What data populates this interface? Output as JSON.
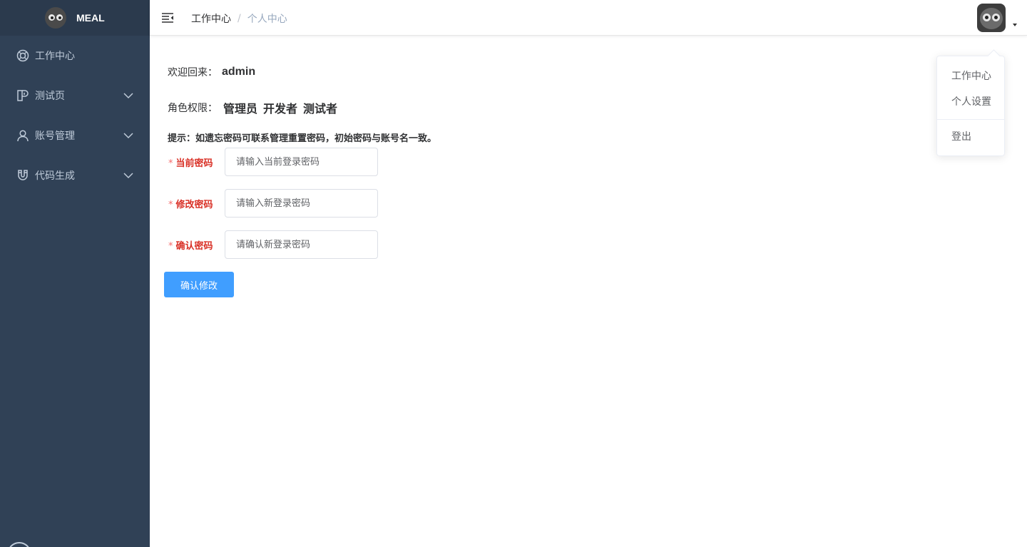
{
  "brand": {
    "title": "MEAL"
  },
  "sidebar": {
    "items": [
      {
        "label": "工作中心",
        "icon": "dashboard-icon",
        "expandable": false
      },
      {
        "label": "测试页",
        "icon": "test-page-icon",
        "expandable": true
      },
      {
        "label": "账号管理",
        "icon": "user-icon",
        "expandable": true
      },
      {
        "label": "代码生成",
        "icon": "magnet-icon",
        "expandable": true
      }
    ]
  },
  "header": {
    "breadcrumb": [
      "工作中心",
      "个人中心"
    ],
    "separator": "/"
  },
  "dropdown": {
    "items": [
      "工作中心",
      "个人设置",
      "登出"
    ]
  },
  "profile": {
    "welcome_label": "欢迎回来：",
    "username": "admin",
    "role_label": "角色权限：",
    "roles": [
      "管理员",
      "开发者",
      "测试者"
    ],
    "tip": "提示：如遗忘密码可联系管理重置密码，初始密码与账号名一致。"
  },
  "form": {
    "current_password": {
      "label": "当前密码",
      "placeholder": "请输入当前登录密码",
      "value": ""
    },
    "new_password": {
      "label": "修改密码",
      "placeholder": "请输入新登录密码",
      "value": ""
    },
    "confirm_password": {
      "label": "确认密码",
      "placeholder": "请确认新登录密码",
      "value": ""
    },
    "required_mark": "*",
    "submit_label": "确认修改"
  },
  "colors": {
    "sidebar_bg": "#304156",
    "brand_bg": "#2b3a4d",
    "sidebar_text": "#bfcbd9",
    "primary": "#409eff",
    "required": "#f56c6c"
  }
}
